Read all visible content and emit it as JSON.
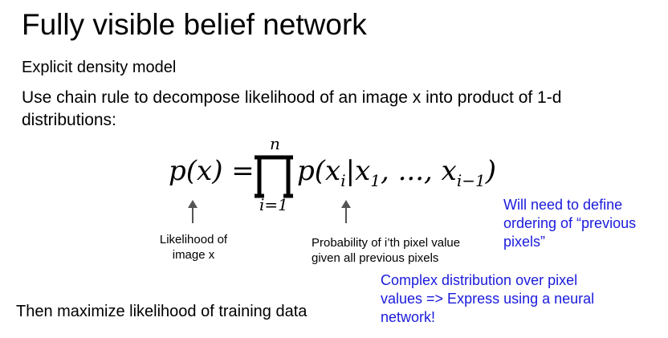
{
  "slide": {
    "title": "Fully visible belief network",
    "subtitle": "Explicit density model",
    "body_line1": "Use chain rule to decompose likelihood of an image x into product of 1-d",
    "body_line2": "distributions:",
    "conclusion": "Then maximize likelihood of training data"
  },
  "formula": {
    "lhs": "p(x) =",
    "product_upper": "n",
    "product_lower": "i=1",
    "rhs": "p(x",
    "rhs_sub_i": "i",
    "rhs_bar": "|x",
    "rhs_sub_1": "1",
    "rhs_dots": ", ..., x",
    "rhs_sub_im1": "i−1",
    "rhs_close": ")"
  },
  "annotations": {
    "likelihood_line1": "Likelihood of",
    "likelihood_line2": "image x",
    "probability_line1": "Probability of i’th pixel value",
    "probability_line2": "given all previous pixels",
    "ordering_line1": "Will need to define",
    "ordering_line2": "ordering of “previous",
    "ordering_line3": "pixels”",
    "complex_line1": "Complex distribution over pixel",
    "complex_line2": "values => Express using a neural",
    "complex_line3": "network!"
  },
  "colors": {
    "annotation_blue": "#1a1adc",
    "arrow_gray": "#555555"
  }
}
